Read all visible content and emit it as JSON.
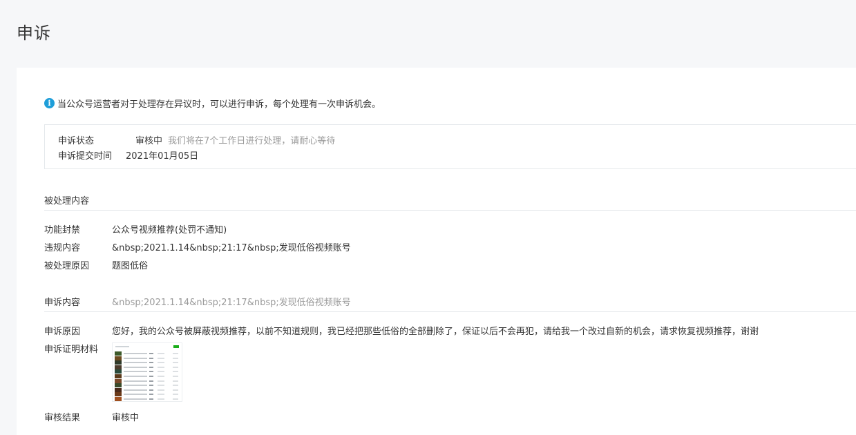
{
  "page": {
    "title": "申诉"
  },
  "notice": {
    "text": "当公众号运营者对于处理存在异议时，可以进行申诉，每个处理有一次申诉机会。"
  },
  "status": {
    "state_label": "申诉状态",
    "state_value": "审核中",
    "state_hint": "我们将在7个工作日进行处理，请耐心等待",
    "time_label": "申诉提交时间",
    "time_value": "2021年01月05日"
  },
  "processed": {
    "section_title": "被处理内容",
    "items": [
      {
        "label": "功能封禁",
        "value": "公众号视频推荐(处罚不通知)"
      },
      {
        "label": "违规内容",
        "value": "&nbsp;2021.1.14&nbsp;21:17&nbsp;发现低俗视频账号"
      },
      {
        "label": "被处理原因",
        "value": "题图低俗"
      }
    ]
  },
  "appeal": {
    "section_label": "申诉内容",
    "section_value": "&nbsp;2021.1.14&nbsp;21:17&nbsp;发现低俗视频账号",
    "reason_label": "申诉原因",
    "reason_value": "您好，我的公众号被屏蔽视频推荐，以前不知道规则，我已经把那些低俗的全部删除了，保证以后不会再犯，请给我一个改过自新的机会，请求恢复视频推荐，谢谢",
    "evidence_label": "申诉证明材料",
    "result_label": "审核结果",
    "result_value": "审核中"
  },
  "colors": {
    "info_icon": "#1e9ed9",
    "muted_text": "#9a9a9a",
    "border": "#e4e8eb"
  },
  "icons": {
    "info": "info-circle-icon"
  }
}
